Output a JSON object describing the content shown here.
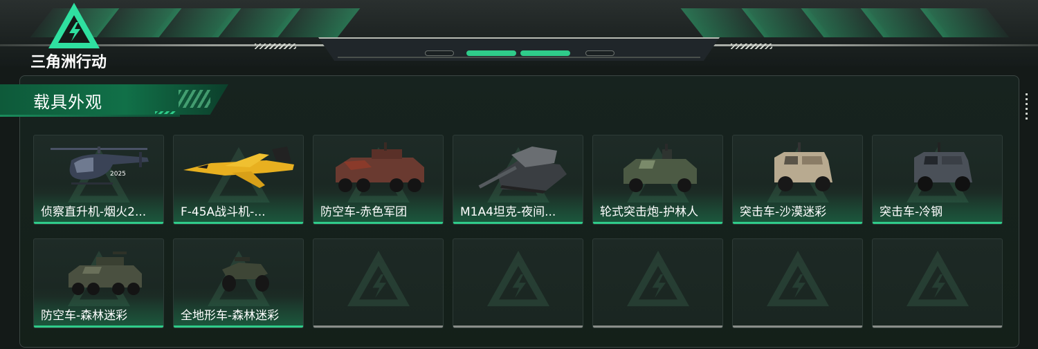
{
  "game": {
    "logo_text": "三角洲行动"
  },
  "colors": {
    "accent": "#2fcc8a",
    "panel_bg": "#142019",
    "header_green": "#117048"
  },
  "section": {
    "title": "载具外观"
  },
  "cards": [
    {
      "name": "侦察直升机-烟火2...",
      "icon": "helicopter-icon",
      "filled": true
    },
    {
      "name": "F-45A战斗机-...",
      "icon": "jet-icon",
      "filled": true
    },
    {
      "name": "防空车-赤色军团",
      "icon": "aa-vehicle-red-icon",
      "filled": true
    },
    {
      "name": "M1A4坦克-夜间...",
      "icon": "tank-icon",
      "filled": true
    },
    {
      "name": "轮式突击炮-护林人",
      "icon": "wheeled-assault-gun-icon",
      "filled": true
    },
    {
      "name": "突击车-沙漠迷彩",
      "icon": "assault-car-desert-icon",
      "filled": true
    },
    {
      "name": "突击车-冷钢",
      "icon": "assault-car-steel-icon",
      "filled": true
    },
    {
      "name": "防空车-森林迷彩",
      "icon": "aa-vehicle-forest-icon",
      "filled": true
    },
    {
      "name": "全地形车-森林迷彩",
      "icon": "atv-icon",
      "filled": true
    },
    {
      "name": "",
      "icon": "empty-slot-icon",
      "filled": false
    },
    {
      "name": "",
      "icon": "empty-slot-icon",
      "filled": false
    },
    {
      "name": "",
      "icon": "empty-slot-icon",
      "filled": false
    },
    {
      "name": "",
      "icon": "empty-slot-icon",
      "filled": false
    },
    {
      "name": "",
      "icon": "empty-slot-icon",
      "filled": false
    }
  ]
}
